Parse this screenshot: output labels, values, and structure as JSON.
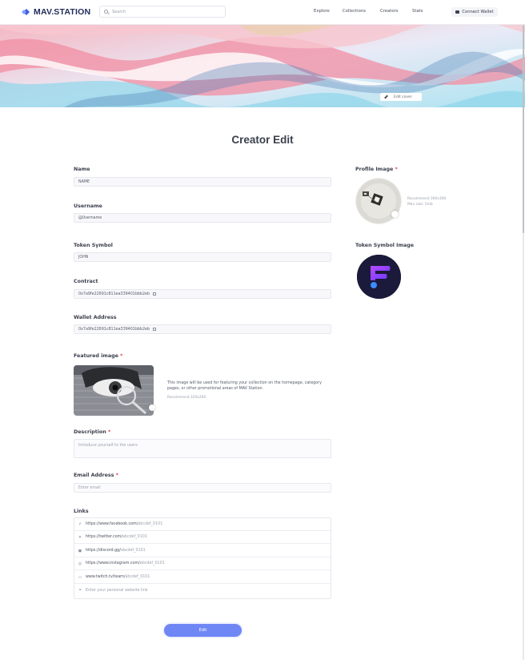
{
  "header": {
    "logo_text": "MAV.STATION",
    "search_placeholder": "Search",
    "nav": [
      "Explore",
      "Collections",
      "Creators",
      "Stats"
    ],
    "connect_wallet": "Connect Wallet"
  },
  "cover": {
    "edit_label": "Edit cover"
  },
  "page_title": "Creator Edit",
  "form": {
    "name": {
      "label": "Name",
      "value": "NAME"
    },
    "username": {
      "label": "Username",
      "value": "@Username"
    },
    "token_symbol": {
      "label": "Token Symbol",
      "value": "JOHN"
    },
    "contract": {
      "label": "Contract",
      "value": "0x7a9fe22691c811ea339401bbb2eb"
    },
    "wallet_address": {
      "label": "Wallet Address",
      "value": "0x7a9fe22691c811ea339401bbb2eb"
    },
    "featured_image": {
      "label": "Featured image",
      "required": "*",
      "description": "This image will be used for featuring your collection on the homepage, category pages, or other promotional areas of MAV Station.",
      "recommend": "Recommend 320x200"
    },
    "description": {
      "label": "Description",
      "required": "*",
      "placeholder": "Introduce yourself to the users"
    },
    "email": {
      "label": "Email Address",
      "required": "*",
      "placeholder": "Enter email"
    },
    "links": {
      "label": "Links",
      "items": [
        {
          "icon": "facebook-icon",
          "prefix": "https://www.facebook.com/",
          "user": "abcdef_0101"
        },
        {
          "icon": "twitter-icon",
          "prefix": "https://twitter.com/",
          "user": "abcdef_0101"
        },
        {
          "icon": "discord-icon",
          "prefix": "https://discord.gg/",
          "user": "abcdef_0101"
        },
        {
          "icon": "instagram-icon",
          "prefix": "https://www.instagram.com/",
          "user": "abcdef_0101"
        },
        {
          "icon": "twitch-icon",
          "prefix": "www.twitch.tv/team/",
          "user": "abcdef_0101"
        },
        {
          "icon": "link-icon",
          "prefix": "",
          "user": "",
          "placeholder": "Enter your personal website link"
        }
      ]
    },
    "submit": "Edit"
  },
  "right": {
    "profile_image": {
      "label": "Profile Image",
      "required": "*",
      "recommend": "Recommend 300x300",
      "max_size": "Max size: 5mb"
    },
    "token_symbol_image": {
      "label": "Token Symbol Image"
    }
  },
  "colors": {
    "accent": "#6f86f5",
    "required": "#e0444c",
    "brand": "#1f2a5a"
  }
}
